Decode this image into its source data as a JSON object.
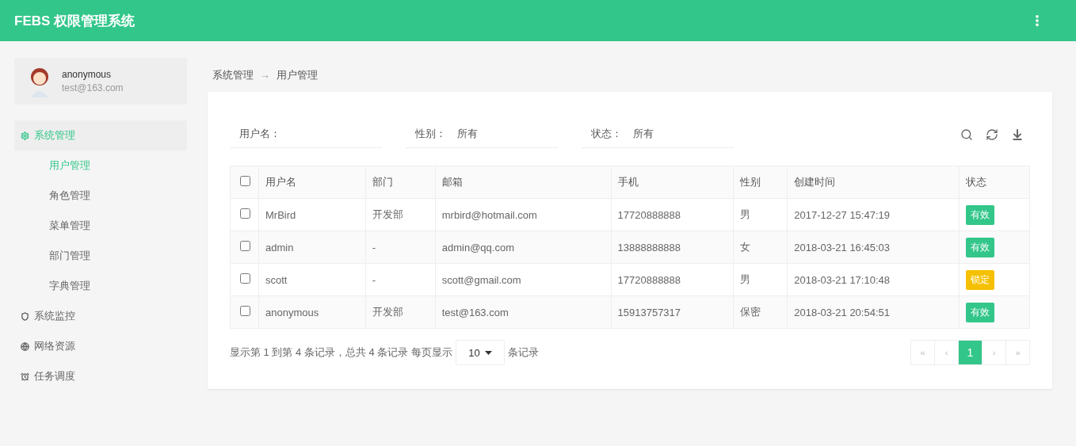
{
  "header": {
    "title": "FEBS 权限管理系统"
  },
  "user": {
    "name": "anonymous",
    "email": "test@163.com"
  },
  "menu": [
    {
      "label": "系统管理",
      "selected": true,
      "children": [
        {
          "label": "用户管理",
          "selected": true
        },
        {
          "label": "角色管理",
          "selected": false
        },
        {
          "label": "菜单管理",
          "selected": false
        },
        {
          "label": "部门管理",
          "selected": false
        },
        {
          "label": "字典管理",
          "selected": false
        }
      ]
    },
    {
      "label": "系统监控",
      "selected": false
    },
    {
      "label": "网络资源",
      "selected": false
    },
    {
      "label": "任务调度",
      "selected": false
    }
  ],
  "breadcrumb": {
    "parent": "系统管理",
    "separator": "→",
    "current": "用户管理"
  },
  "filters": [
    {
      "label": "用户名："
    },
    {
      "label": "性别：",
      "value": "所有"
    },
    {
      "label": "状态：",
      "value": "所有"
    }
  ],
  "table": {
    "select_all": {
      "checked": false
    },
    "columns": [
      "用户名",
      "部门",
      "邮箱",
      "手机",
      "性别",
      "创建时间",
      "状态"
    ],
    "rows": [
      {
        "checked": false,
        "cells": [
          "MrBird",
          "开发部",
          "mrbird@hotmail.com",
          "17720888888",
          "男",
          "2017-12-27 15:47:19"
        ],
        "status": {
          "text": "有效",
          "color": "#33c68a"
        }
      },
      {
        "checked": false,
        "cells": [
          "admin",
          "-",
          "admin@qq.com",
          "13888888888",
          "女",
          "2018-03-21 16:45:03"
        ],
        "status": {
          "text": "有效",
          "color": "#33c68a"
        }
      },
      {
        "checked": false,
        "cells": [
          "scott",
          "-",
          "scott@gmail.com",
          "17720888888",
          "男",
          "2018-03-21 17:10:48"
        ],
        "status": {
          "text": "锁定",
          "color": "#f5c000"
        }
      },
      {
        "checked": false,
        "cells": [
          "anonymous",
          "开发部",
          "test@163.com",
          "15913757317",
          "保密",
          "2018-03-21 20:54:51"
        ],
        "status": {
          "text": "有效",
          "color": "#33c68a"
        }
      }
    ]
  },
  "footer": {
    "summary": "显示第 1 到第 4 条记录，总共 4 条记录 每页显示",
    "page_size": "10",
    "suffix": "条记录"
  },
  "pagination": [
    {
      "label": "«",
      "selected": false
    },
    {
      "label": "‹",
      "selected": false
    },
    {
      "label": "1",
      "selected": true
    },
    {
      "label": "›",
      "selected": false
    },
    {
      "label": "»",
      "selected": false
    }
  ]
}
